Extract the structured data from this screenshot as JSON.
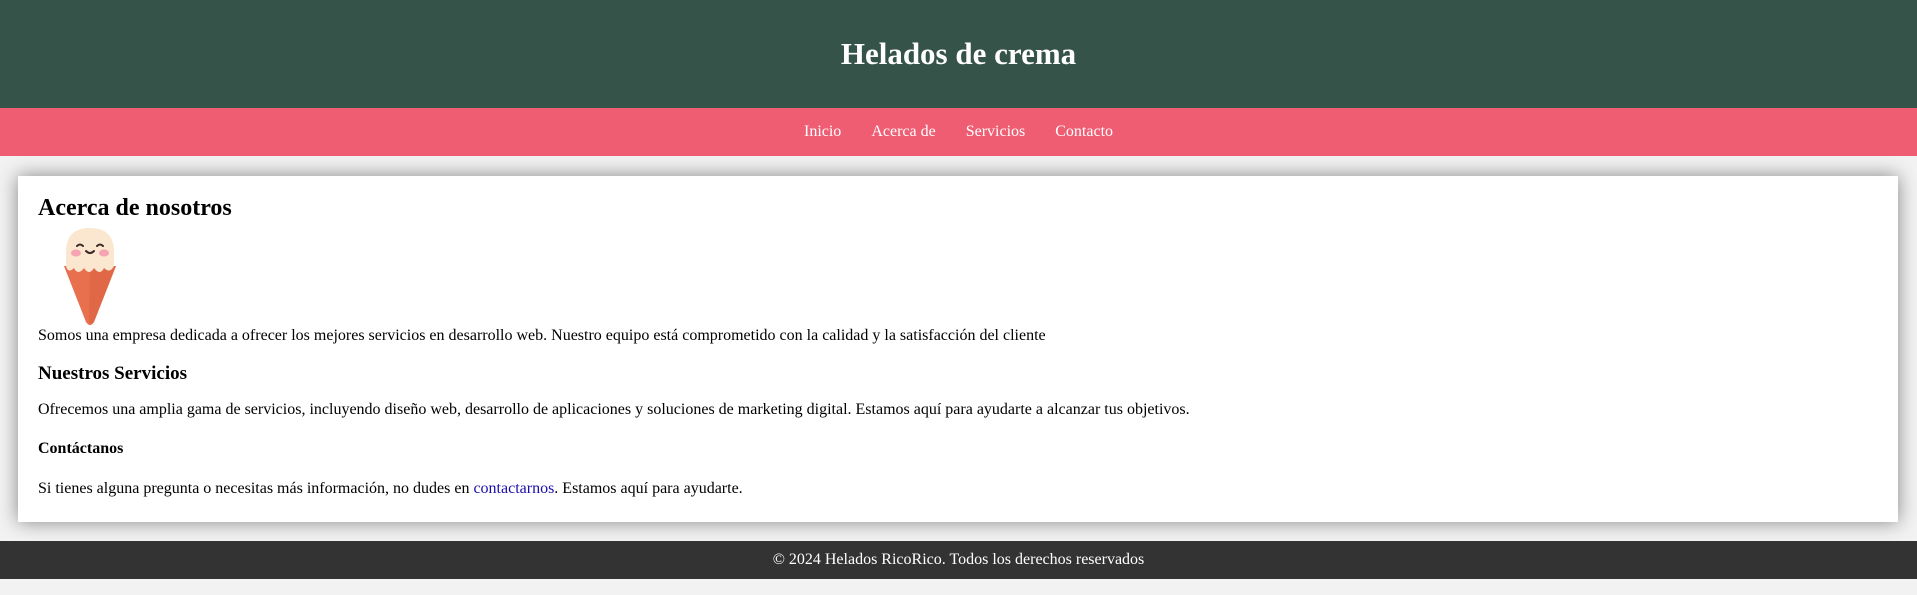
{
  "header": {
    "title": "Helados de crema"
  },
  "nav": {
    "items": [
      "Inicio",
      "Acerca de",
      "Servicios",
      "Contacto"
    ]
  },
  "about": {
    "heading": "Acerca de nosotros",
    "text": "Somos una empresa dedicada a ofrecer los mejores servicios en desarrollo web. Nuestro equipo está comprometido con la calidad y la satisfacción del cliente"
  },
  "services": {
    "heading": "Nuestros Servicios",
    "text": "Ofrecemos una amplia gama de servicios, incluyendo diseño web, desarrollo de aplicaciones y soluciones de marketing digital. Estamos aquí para ayudarte a alcanzar tus objetivos."
  },
  "contact": {
    "heading": "Contáctanos",
    "text_before": "Si tienes alguna pregunta o necesitas más información, no dudes en ",
    "link": "contactarnos",
    "text_after": ". Estamos aquí para ayudarte."
  },
  "footer": {
    "text": "© 2024 Helados RicoRico. Todos los derechos reservados"
  },
  "colors": {
    "header_bg": "#365349",
    "nav_bg": "#ef5d73",
    "footer_bg": "#333333",
    "page_bg": "#f2f2f2"
  },
  "icons": {
    "illustration": "ice-cream-cone-icon"
  }
}
